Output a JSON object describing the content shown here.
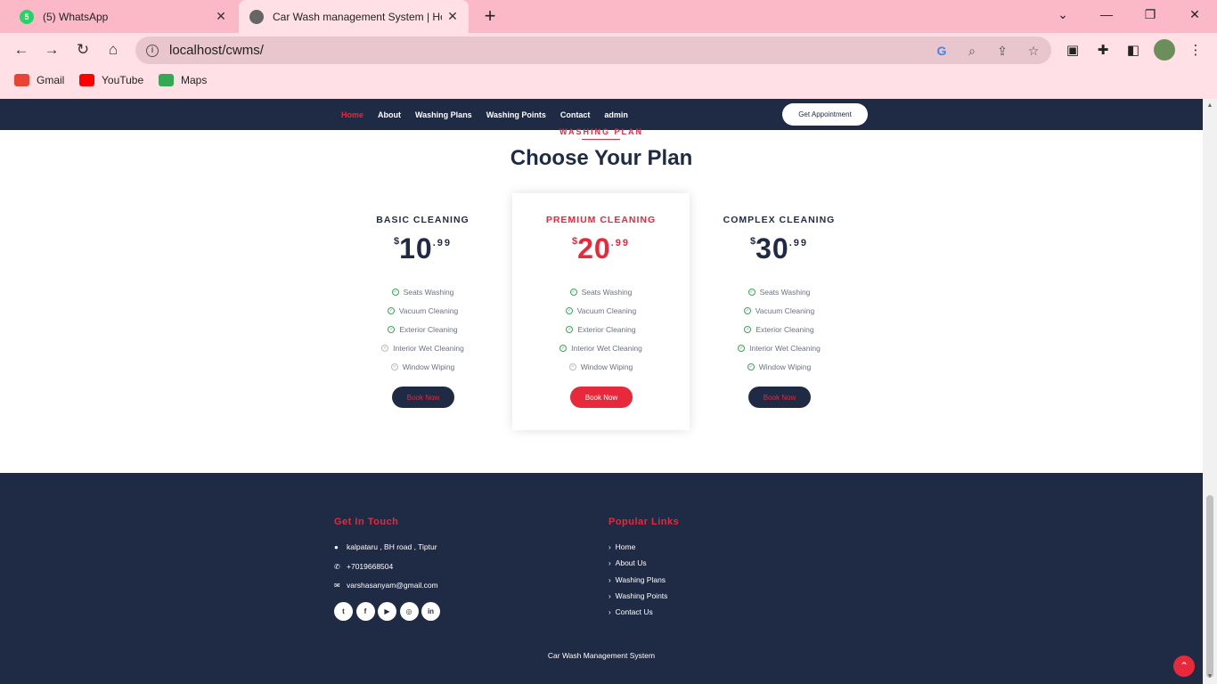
{
  "browser": {
    "tabs": [
      {
        "title": "(5) WhatsApp",
        "badge": "5"
      },
      {
        "title": "Car Wash management System | Ho"
      }
    ],
    "url": "localhost/cwms/",
    "bookmarks": [
      "Gmail",
      "YouTube",
      "Maps"
    ]
  },
  "site": {
    "nav": [
      "Home",
      "About",
      "Washing Plans",
      "Washing Points",
      "Contact",
      "admin"
    ],
    "appointment_button": "Get Appointment",
    "section_tag": "WASHING PLAN",
    "section_title": "Choose Your Plan",
    "plans": [
      {
        "name": "BASIC CLEANING",
        "currency": "$",
        "price": "10",
        "cents": ".99",
        "button": "Book Now",
        "features": [
          {
            "label": "Seats Washing",
            "included": true
          },
          {
            "label": "Vacuum Cleaning",
            "included": true
          },
          {
            "label": "Exterior Cleaning",
            "included": true
          },
          {
            "label": "Interior Wet Cleaning",
            "included": false
          },
          {
            "label": "Window Wiping",
            "included": false
          }
        ]
      },
      {
        "name": "PREMIUM CLEANING",
        "currency": "$",
        "price": "20",
        "cents": ".99",
        "button": "Book Now",
        "features": [
          {
            "label": "Seats Washing",
            "included": true
          },
          {
            "label": "Vacuum Cleaning",
            "included": true
          },
          {
            "label": "Exterior Cleaning",
            "included": true
          },
          {
            "label": "Interior Wet Cleaning",
            "included": true
          },
          {
            "label": "Window Wiping",
            "included": false
          }
        ]
      },
      {
        "name": "COMPLEX CLEANING",
        "currency": "$",
        "price": "30",
        "cents": ".99",
        "button": "Book Now",
        "features": [
          {
            "label": "Seats Washing",
            "included": true
          },
          {
            "label": "Vacuum Cleaning",
            "included": true
          },
          {
            "label": "Exterior Cleaning",
            "included": true
          },
          {
            "label": "Interior Wet Cleaning",
            "included": true
          },
          {
            "label": "Window Wiping",
            "included": true
          }
        ]
      }
    ],
    "footer": {
      "get_in_touch": "Get In Touch",
      "address": "kalpataru , BH road , Tiptur",
      "phone": "+7019668504",
      "email": "varshasanyam@gmail.com",
      "popular_links_title": "Popular Links",
      "popular_links": [
        "Home",
        "About Us",
        "Washing Plans",
        "Washing Points",
        "Contact Us"
      ],
      "copyright": "Car Wash Management System"
    }
  },
  "colors": {
    "navy": "#1f2a44",
    "accent": "#e8283b",
    "chrome": "#fbb8c6"
  }
}
